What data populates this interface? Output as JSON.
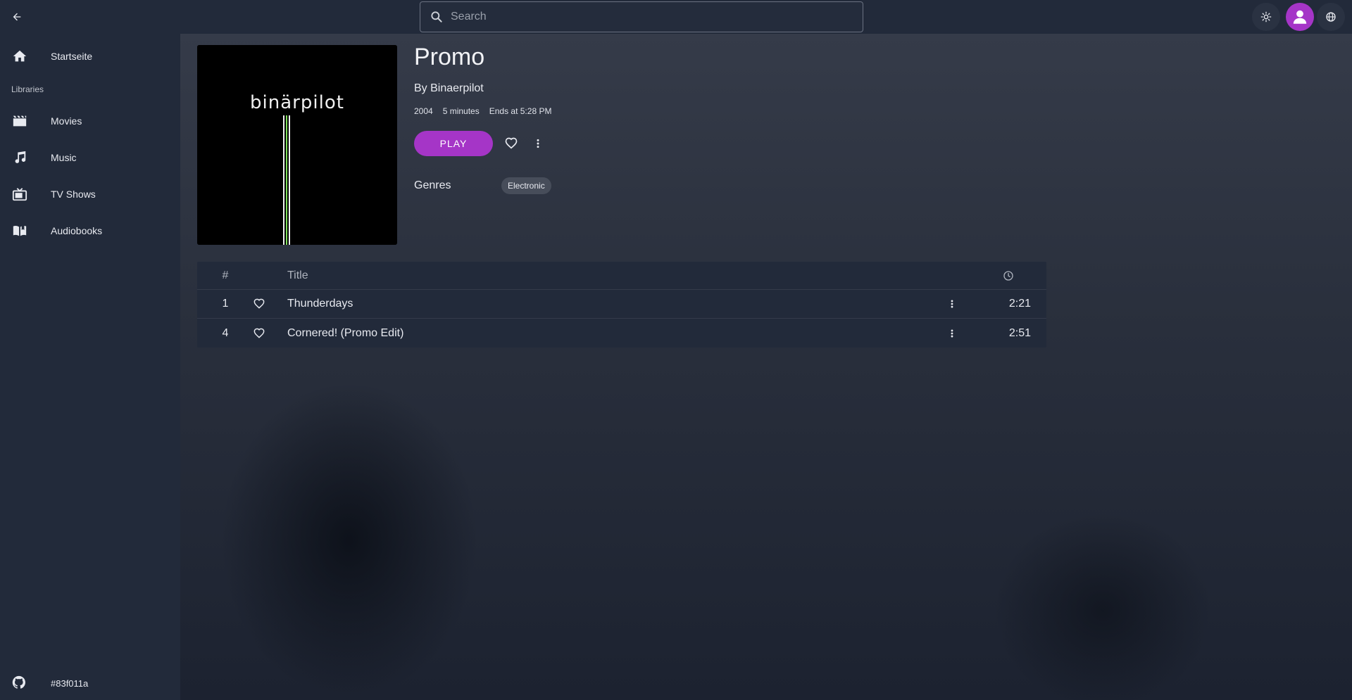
{
  "topbar": {
    "search_placeholder": "Search"
  },
  "sidebar": {
    "home_label": "Startseite",
    "section_label": "Libraries",
    "items": [
      {
        "label": "Movies",
        "icon": "movie-clapper-icon"
      },
      {
        "label": "Music",
        "icon": "music-note-icon"
      },
      {
        "label": "TV Shows",
        "icon": "tv-icon"
      },
      {
        "label": "Audiobooks",
        "icon": "book-icon"
      }
    ],
    "footer_label": "#83f011a",
    "footer_icon": "github-icon"
  },
  "album": {
    "cover_text": "binärpilot",
    "title": "Promo",
    "artist": "By Binaerpilot",
    "year": "2004",
    "duration": "5 minutes",
    "ends_at": "Ends at 5:28 PM",
    "play_label": "PLAY",
    "genres_label": "Genres",
    "genres": [
      "Electronic"
    ]
  },
  "tracks": {
    "headers": {
      "number": "#",
      "title": "Title"
    },
    "rows": [
      {
        "number": "1",
        "title": "Thunderdays",
        "duration": "2:21"
      },
      {
        "number": "4",
        "title": "Cornered! (Promo Edit)",
        "duration": "2:51"
      }
    ]
  },
  "colors": {
    "accent": "#a535c7",
    "topbar_bg": "#222a3a",
    "sidebar_bg": "#222a3a"
  }
}
